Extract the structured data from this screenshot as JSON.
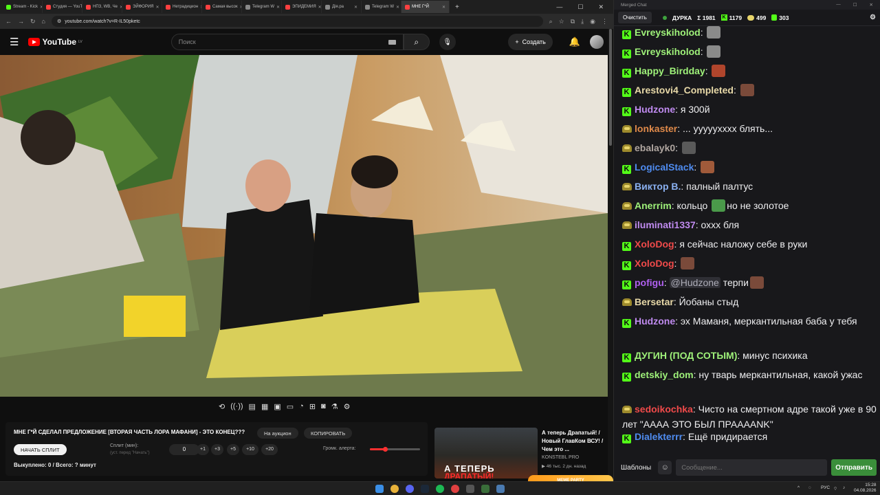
{
  "browser": {
    "tabs": [
      {
        "label": "Stream - Kick",
        "color": "#53fc18"
      },
      {
        "label": "Студия — YouTube",
        "color": "#ff4040"
      },
      {
        "label": "НПЗ, WB, Че",
        "color": "#ff4040"
      },
      {
        "label": "ЭЙФОРИЯ",
        "color": "#ff4040"
      },
      {
        "label": "Нетрадицион",
        "color": "#ff4040"
      },
      {
        "label": "Самая высок",
        "color": "#ff4040"
      },
      {
        "label": "Telegram W",
        "color": "#888888"
      },
      {
        "label": "ЭПИДЕМИЯ",
        "color": "#ff4040"
      },
      {
        "label": "Дiя.ра",
        "color": "#888888"
      },
      {
        "label": "Telegram W",
        "color": "#888888"
      },
      {
        "label": "МНЕ Г*Й",
        "color": "#ff4040",
        "active": true
      }
    ],
    "url": "youtube.com/watch?v=R-IL50pketc"
  },
  "youtube": {
    "logo": "YouTube",
    "region": "LV",
    "search_placeholder": "Поиск",
    "create_label": "Создать"
  },
  "panel": {
    "title": "МНЕ Г*Й СДЕЛАЛ ПРЕДЛОЖЕНИЕ [ВТОРАЯ ЧАСТЬ ЛОРА МАФАНИ] - ЭТО КОНЕЦ???",
    "auction_label": "На аукцион",
    "copy_label": "КОПИРОВАТЬ",
    "start_split_label": "НАЧАТЬ СПЛИТ",
    "split_label": "Сплит (мин):",
    "split_hint": "(уст. перед \"Начать\")",
    "split_value": "0",
    "steps": [
      "+1",
      "+3",
      "+5",
      "+10",
      "+20"
    ],
    "alert_volume_label": "Громк. алерта:",
    "alert_volume": 0.3,
    "status": "Выкуплено: 0 / Всего: ? минут"
  },
  "recommended": {
    "thumb_text": "А ТЕПЕРЬ",
    "thumb_text_red": "ДРАПАТЫЙ!",
    "title": "А теперь Драпатый! / Новый ГлавКом ВСУ! / Чем это ...",
    "channel": "KONSTEBL PRO",
    "meta": "▶ 46 тыс.  2 дн. назад"
  },
  "chat": {
    "window_title": "Merged Chat",
    "clear_label": "Очистить",
    "channel": "ДУРКА",
    "stats": {
      "sum": "Σ 1981",
      "kick": "1179",
      "twitch": "499",
      "other": "303"
    },
    "messages": [
      {
        "platform": "kick",
        "user": "Evreyskiholod",
        "color": "#9ff27a",
        "text": "",
        "emote": "#8a8a8a"
      },
      {
        "platform": "kick",
        "user": "Evreyskiholod",
        "color": "#9ff27a",
        "text": "",
        "emote": "#8a8a8a"
      },
      {
        "platform": "kick",
        "user": "Happy_Birdday",
        "color": "#9ff27a",
        "text": "",
        "emote": "#b0452c"
      },
      {
        "platform": "kick",
        "user": "Arestovi4_Completed",
        "color": "#e8d9a8",
        "text": "",
        "emote": "#7a4a3a"
      },
      {
        "platform": "kick",
        "user": "Hudzone",
        "color": "#c08bf0",
        "text": "я 300й"
      },
      {
        "platform": "twitch",
        "user": "lonkaster",
        "color": "#e08a4a",
        "text": "... уууууxxxx блять..."
      },
      {
        "platform": "twitch",
        "user": "ebalayk0",
        "color": "#b0a6a0",
        "text": "",
        "emote": "#5a5a5a"
      },
      {
        "platform": "kick",
        "user": "LogicalStack",
        "color": "#4f8cf0",
        "text": "",
        "emote": "#a05a3a"
      },
      {
        "platform": "twitch",
        "user": "Виктор В.",
        "color": "#8ab0f0",
        "text": "палный палтус"
      },
      {
        "platform": "twitch",
        "user": "Anerrim",
        "color": "#9ff27a",
        "text": "кольцо ",
        "emote": "#4a9a4a",
        "text2": "но не золотое"
      },
      {
        "platform": "twitch",
        "user": "iluminati1337",
        "color": "#c08bf0",
        "text": "охxx бля"
      },
      {
        "platform": "kick",
        "user": "XoloDog",
        "color": "#f04a4a",
        "text": "я сейчас наложу себе в руки"
      },
      {
        "platform": "kick",
        "user": "XoloDog",
        "color": "#f04a4a",
        "text": "",
        "emote": "#7a4a3a"
      },
      {
        "platform": "kick",
        "user": "pofigu",
        "color": "#b060f0",
        "mention": "@Hudzone",
        "text": " терпи",
        "emote": "#7a4a3a"
      },
      {
        "platform": "twitch",
        "user": "Bersetar",
        "color": "#e8d9a8",
        "text": "Йобаны стыд"
      },
      {
        "platform": "kick",
        "user": "Hudzone",
        "color": "#c08bf0",
        "text": "эх Маманя, меркантильная баба у тебя"
      },
      {
        "platform": "kick",
        "user": "ДУГИН (ПОД СОТЫМ)",
        "color": "#9ff27a",
        "text": "минус психика"
      },
      {
        "platform": "kick",
        "user": "detskiy_dom",
        "color": "#9ff27a",
        "text": "ну тварь меркантильная, какой ужас"
      },
      {
        "platform": "twitch",
        "user": "sedoikochka",
        "color": "#f04a4a",
        "text": "Чисто на смертном адре такой уже в 90 лет \"АААА ЭТО БЫЛ ПРАААANK\""
      },
      {
        "platform": "kick",
        "user": "Dialekterrr",
        "color": "#4f8cf0",
        "text": "Ещё придирается"
      }
    ],
    "templates_label": "Шаблоны",
    "input_placeholder": "Сообщение...",
    "send_label": "Отправить"
  },
  "taskbar": {
    "meme_party": "MEME PARTY",
    "lang": "РУС",
    "time": "15:28",
    "date": "04.08.2026"
  }
}
